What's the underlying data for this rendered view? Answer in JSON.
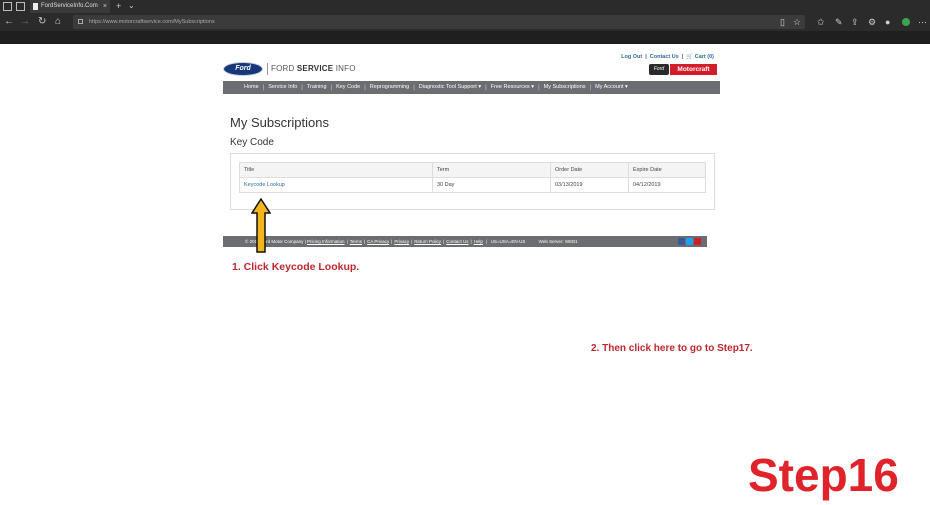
{
  "browser": {
    "tab_title": "FordServiceInfo.Com",
    "tab_close": "×",
    "new_tab": "+",
    "tab_menu": "⌄",
    "url": "https://www.motorcraftservice.com/MySubscriptions"
  },
  "site": {
    "top_links": {
      "logout": "Log Out",
      "contact": "Contact Us",
      "cart": "Cart (0)",
      "cart_icon": "cart-icon"
    },
    "logo_text": "Ford",
    "brand_light": "FORD ",
    "brand_bold": "SERVICE",
    "brand_tail": " INFO",
    "motorcraft_ford": "Ford",
    "motorcraft_label": "Motorcraft",
    "nav": [
      "Home",
      "Service Info",
      "Training",
      "Key Code",
      "Reprogramming",
      "Diagnostic Tool Support ▾",
      "Free Resources ▾",
      "My Subscriptions",
      "My Account ▾"
    ]
  },
  "main": {
    "title": "My Subscriptions",
    "section": "Key Code",
    "table": {
      "headers": [
        "Title",
        "Term",
        "Order Date",
        "Expire Date"
      ],
      "rows": [
        {
          "title": "Keycode Lookup",
          "term": "30 Day",
          "order_date": "03/13/2019",
          "expire_date": "04/12/2019"
        }
      ]
    }
  },
  "footer": {
    "copyright": "© 2019 Ford Motor Company |",
    "links": [
      "Pricing Information",
      "Terms",
      "CA Privacy",
      "Privacy",
      "Return Policy",
      "Contact Us",
      "Help"
    ],
    "locale": "US=USA=EN-US",
    "server": "Web Server: WEB1"
  },
  "annotations": {
    "instruction_1": "1. Click Keycode Lookup.",
    "instruction_2": "2. Then click here to go to Step17.",
    "step": "Step16"
  },
  "colors": {
    "annotation_red": "#c0272d",
    "step_red": "#e0232a",
    "arrow_fill": "#f3b51b",
    "link_blue": "#2d6ca2",
    "nav_grey": "#6b6d70",
    "motorcraft_red": "#d21d2a"
  }
}
